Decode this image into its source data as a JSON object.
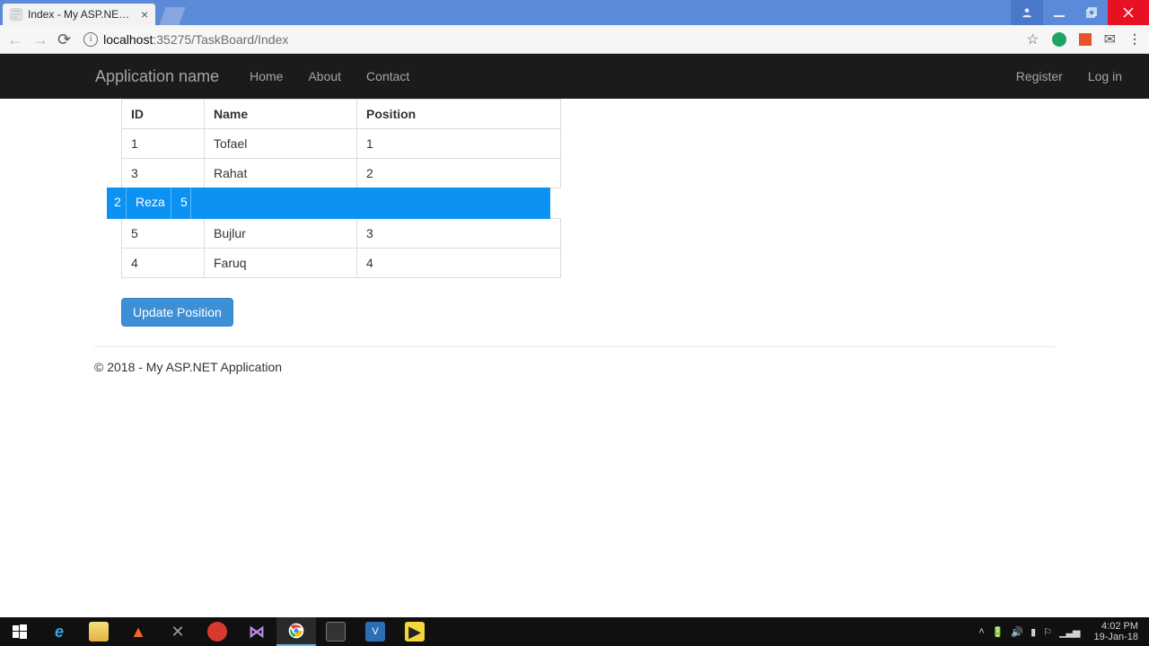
{
  "window": {
    "tab_title": "Index - My ASP.NET Appl",
    "url_host": "localhost",
    "url_port_path": ":35275/TaskBoard/Index"
  },
  "nav": {
    "brand": "Application name",
    "home": "Home",
    "about": "About",
    "contact": "Contact",
    "register": "Register",
    "login": "Log in"
  },
  "table": {
    "head": {
      "id": "ID",
      "name": "Name",
      "position": "Position"
    },
    "rows_top": [
      {
        "id": "1",
        "name": "Tofael",
        "position": "1"
      },
      {
        "id": "3",
        "name": "Rahat",
        "position": "2"
      }
    ],
    "drag_row": {
      "id": "2",
      "name": "Reza",
      "position": "5"
    },
    "rows_bottom": [
      {
        "id": "5",
        "name": "Bujlur",
        "position": "3"
      },
      {
        "id": "4",
        "name": "Faruq",
        "position": "4"
      }
    ]
  },
  "buttons": {
    "update": "Update Position"
  },
  "footer": {
    "text": "© 2018 - My ASP.NET Application"
  },
  "tray": {
    "time": "4:02 PM",
    "date": "19-Jan-18"
  }
}
